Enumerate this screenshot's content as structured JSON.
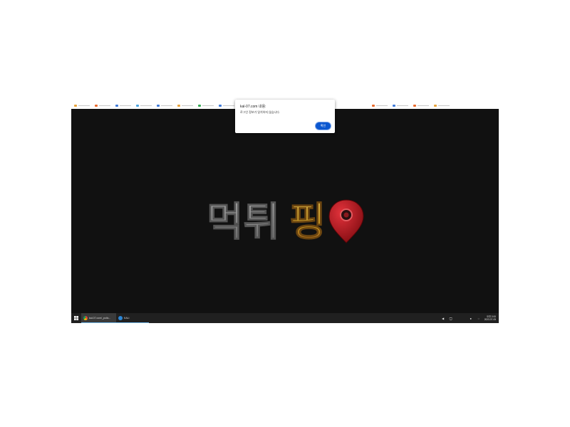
{
  "dialog": {
    "title": "kal-07.com 내용:",
    "message": "로그인 정보가 일치하지 않습니다.",
    "ok_label": "확인"
  },
  "logo": {
    "gray_text": "먹튀",
    "gold_text": "핑",
    "icon": "map-pin-icon"
  },
  "taskbar": {
    "start_icon": "windows-logo-icon",
    "tasks": [
      {
        "label": "kal-07.com/_pollo...",
        "icon": "chrome-icon"
      },
      {
        "label": "KALi",
        "icon": "app-icon"
      }
    ],
    "tray_icons": [
      "chevron-icon",
      "network-icon",
      "volume-icon",
      "notification-icon"
    ],
    "time": "오전 2:00",
    "date": "2023-07-05"
  },
  "colors": {
    "page_bg": "#111111",
    "dialog_button": "#0b57d0",
    "logo_gray": "#8a8a8a",
    "logo_gold": "#c8a032",
    "pin_red": "#b3141c",
    "taskbar_bg": "#202020"
  }
}
